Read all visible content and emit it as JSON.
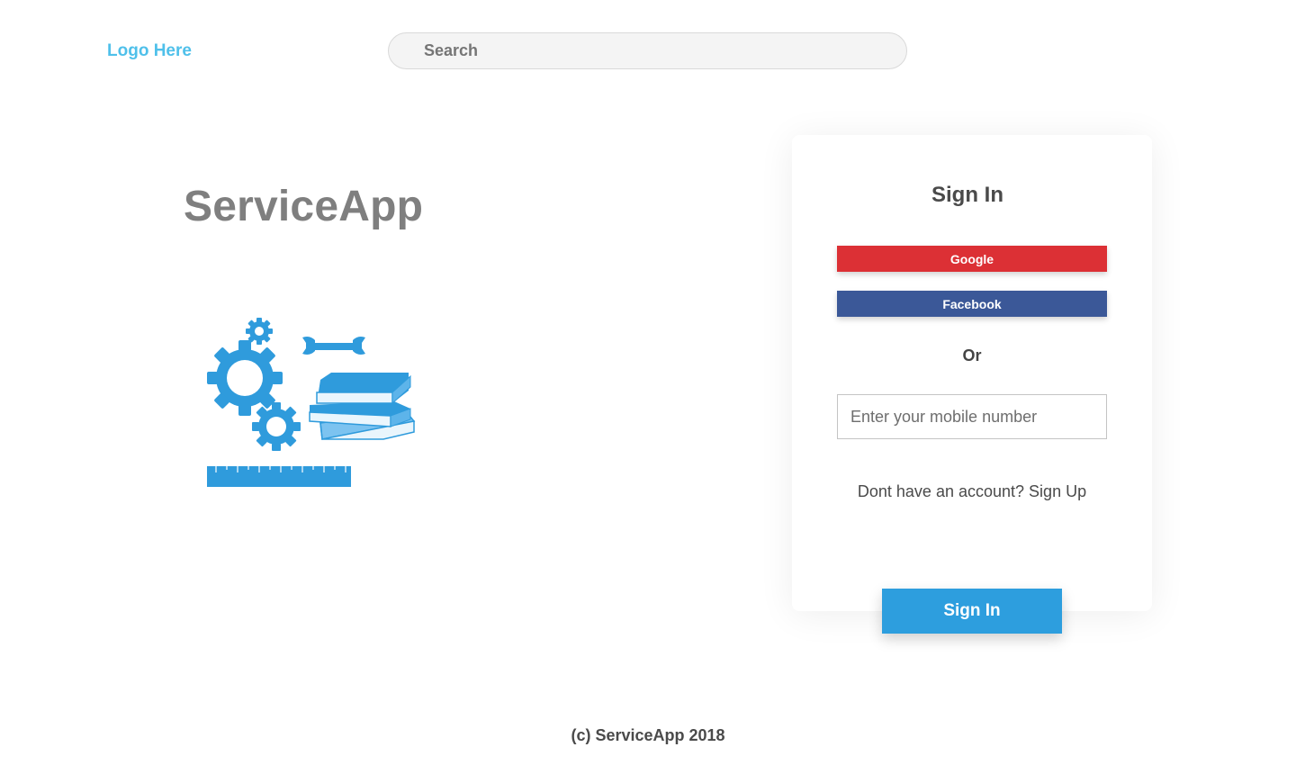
{
  "header": {
    "logo_text": "Logo Here",
    "search_placeholder": "Search"
  },
  "hero": {
    "title": "ServiceApp",
    "illustration_icon": "tools-gears-books-icon"
  },
  "signin_card": {
    "title": "Sign In",
    "google_label": "Google",
    "facebook_label": "Facebook",
    "or_text": "Or",
    "mobile_placeholder": "Enter your mobile number",
    "mobile_value": "",
    "signup_prompt": "Dont have an account?",
    "signup_link": "Sign Up",
    "submit_label": "Sign In"
  },
  "footer": {
    "copyright": "(c) ServiceApp 2018"
  },
  "colors": {
    "logo": "#4fc0ea",
    "google": "#dc3035",
    "facebook": "#3b5898",
    "primary": "#2d9ede",
    "illustration": "#2f9bdc"
  }
}
